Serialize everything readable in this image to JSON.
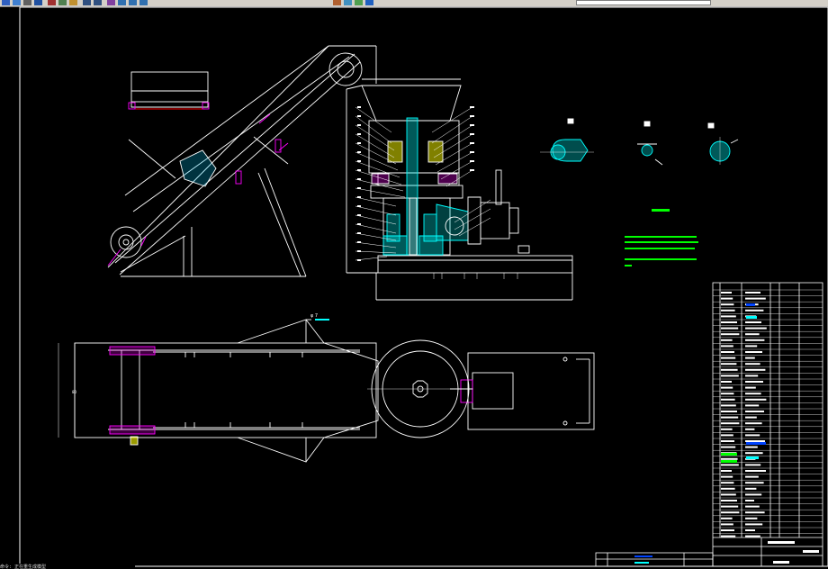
{
  "app": {
    "toolbar_buttons": [
      {
        "icon": "open-icon",
        "color": "#3060c0"
      },
      {
        "icon": "save-icon",
        "color": "#4080d0"
      },
      {
        "icon": "print-icon",
        "color": "#606060"
      },
      {
        "icon": "preview-icon",
        "color": "#2050a0"
      },
      {
        "icon": "cut-icon",
        "color": "#a03030"
      },
      {
        "icon": "copy-icon",
        "color": "#508050"
      },
      {
        "icon": "paste-icon",
        "color": "#c09030"
      },
      {
        "icon": "undo-icon",
        "color": "#305080"
      },
      {
        "icon": "redo-icon",
        "color": "#305080"
      },
      {
        "icon": "pan-icon",
        "color": "#8040a0"
      },
      {
        "icon": "zoom-realtime-icon",
        "color": "#3070b0"
      },
      {
        "icon": "zoom-window-icon",
        "color": "#3070b0"
      },
      {
        "icon": "zoom-previous-icon",
        "color": "#3070b0"
      },
      {
        "icon": "properties-icon",
        "color": "#b06030"
      },
      {
        "icon": "design-center-icon",
        "color": "#4090c0"
      },
      {
        "icon": "tool-palettes-icon",
        "color": "#50a050"
      },
      {
        "icon": "help-icon",
        "color": "#2060c0"
      }
    ],
    "layer_dropdown_value": "",
    "colors": {
      "background": "#000000",
      "linework": "#ffffff",
      "hatch": "#00ffff",
      "section_hatch": "#00cccc",
      "leader": "#ff00ff",
      "notes": "#00ff00",
      "accent_red": "#ff0000",
      "accent_yellow": "#ffff00",
      "accent_blue": "#0000ff"
    }
  },
  "drawing": {
    "views": [
      {
        "name": "belt-conveyor-side-view"
      },
      {
        "name": "pellet-mill-section-view"
      },
      {
        "name": "detail-views"
      },
      {
        "name": "plan-view"
      }
    ],
    "dimension_note": "φ 7",
    "left_height_label": "80"
  },
  "command_line": {
    "text": "命令: 正在重生成模型"
  }
}
